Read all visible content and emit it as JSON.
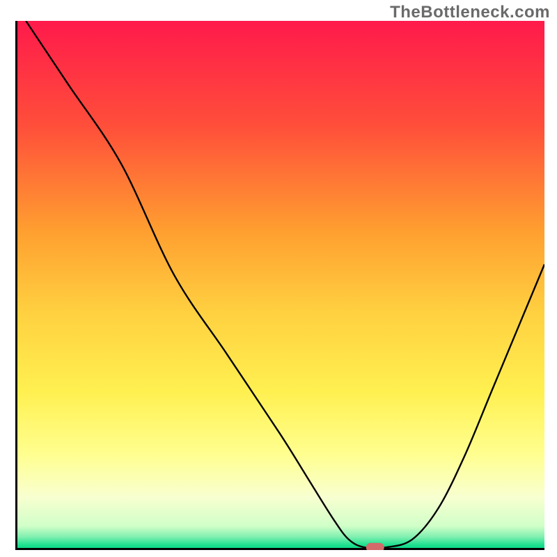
{
  "watermark": "TheBottleneck.com",
  "chart_data": {
    "type": "line",
    "title": "",
    "xlabel": "",
    "ylabel": "",
    "xlim": [
      0,
      100
    ],
    "ylim": [
      0,
      100
    ],
    "x": [
      2,
      10,
      20,
      30,
      40,
      50,
      55,
      60,
      63,
      66,
      70,
      75,
      80,
      85,
      90,
      95,
      100
    ],
    "values": [
      100,
      88,
      73,
      52,
      37,
      22,
      14,
      6,
      2,
      0.5,
      0.5,
      2,
      8,
      18,
      30,
      42,
      54
    ],
    "annotations": [
      {
        "type": "marker",
        "x": 68,
        "y": 0.5,
        "color": "#d46a6a",
        "shape": "rounded-rect"
      }
    ],
    "background": {
      "type": "vertical-gradient",
      "stops": [
        {
          "pos": 0.0,
          "color": "#ff1a4b"
        },
        {
          "pos": 0.2,
          "color": "#ff4f3a"
        },
        {
          "pos": 0.4,
          "color": "#ffa030"
        },
        {
          "pos": 0.55,
          "color": "#ffd040"
        },
        {
          "pos": 0.7,
          "color": "#fff050"
        },
        {
          "pos": 0.82,
          "color": "#ffff90"
        },
        {
          "pos": 0.9,
          "color": "#f8ffd0"
        },
        {
          "pos": 0.955,
          "color": "#d0ffc8"
        },
        {
          "pos": 0.975,
          "color": "#80f0b0"
        },
        {
          "pos": 0.99,
          "color": "#20e090"
        },
        {
          "pos": 1.0,
          "color": "#00d080"
        }
      ]
    },
    "axis_color": "#000000",
    "line_color": "#000000"
  }
}
